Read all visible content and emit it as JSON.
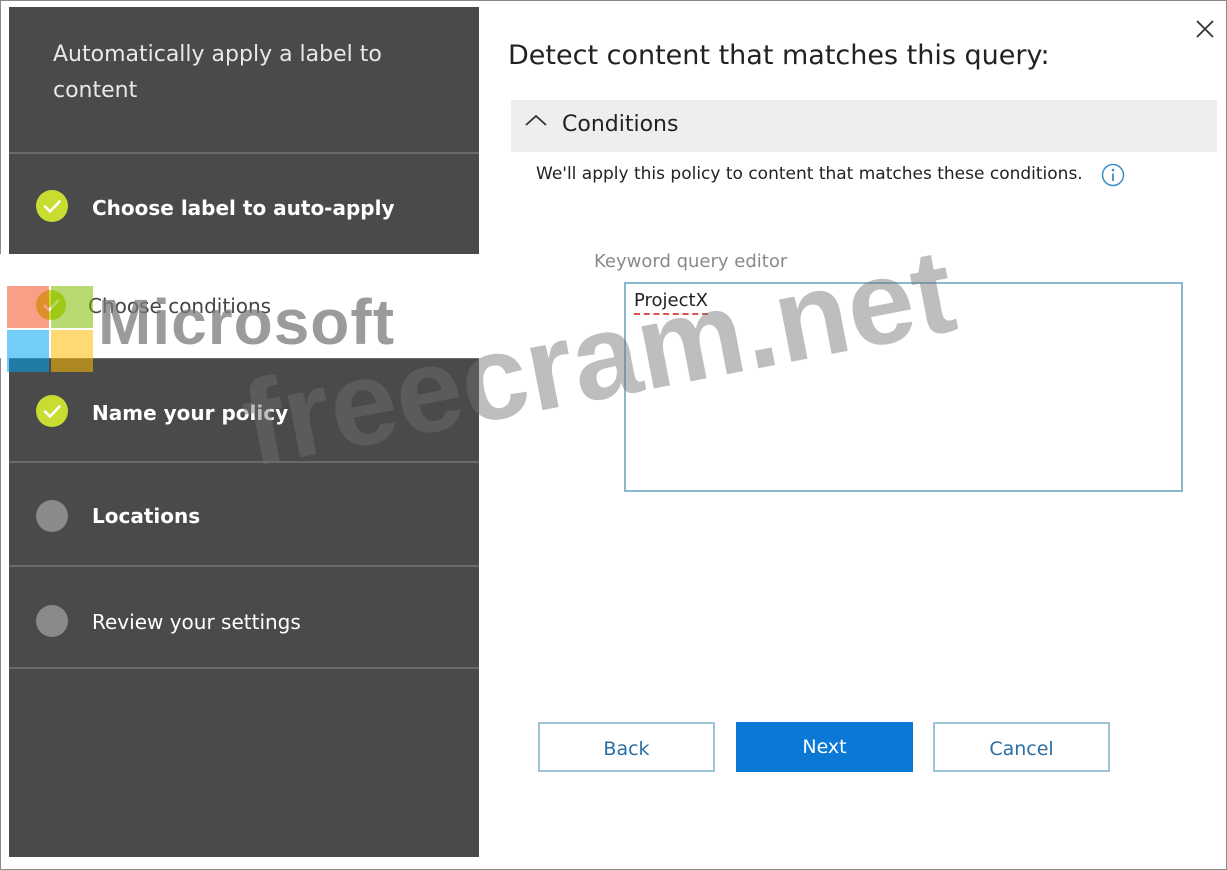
{
  "sidebar": {
    "title": "Automatically apply a label to content",
    "steps": [
      {
        "label": "Choose label to auto-apply",
        "status": "done"
      },
      {
        "label": "Choose conditions",
        "status": "current"
      },
      {
        "label": "Name your policy",
        "status": "done"
      },
      {
        "label": "Locations",
        "status": "pending"
      },
      {
        "label": "Review your settings",
        "status": "pending"
      }
    ]
  },
  "main": {
    "title": "Detect content that matches this query:",
    "conditions_label": "Conditions",
    "conditions_description": "We'll apply this policy to content that matches these conditions.",
    "keyword_query_label": "Keyword query editor",
    "keyword_query_value": "ProjectX"
  },
  "buttons": {
    "back": "Back",
    "next": "Next",
    "cancel": "Cancel"
  },
  "watermark": {
    "brand": "Microsoft",
    "site": "freecram.net"
  },
  "colors": {
    "sidebar_bg": "#4a4a4a",
    "done_check": "#c8dc32",
    "pending_dot": "#8a8a8a",
    "primary_button": "#0a78d4"
  }
}
